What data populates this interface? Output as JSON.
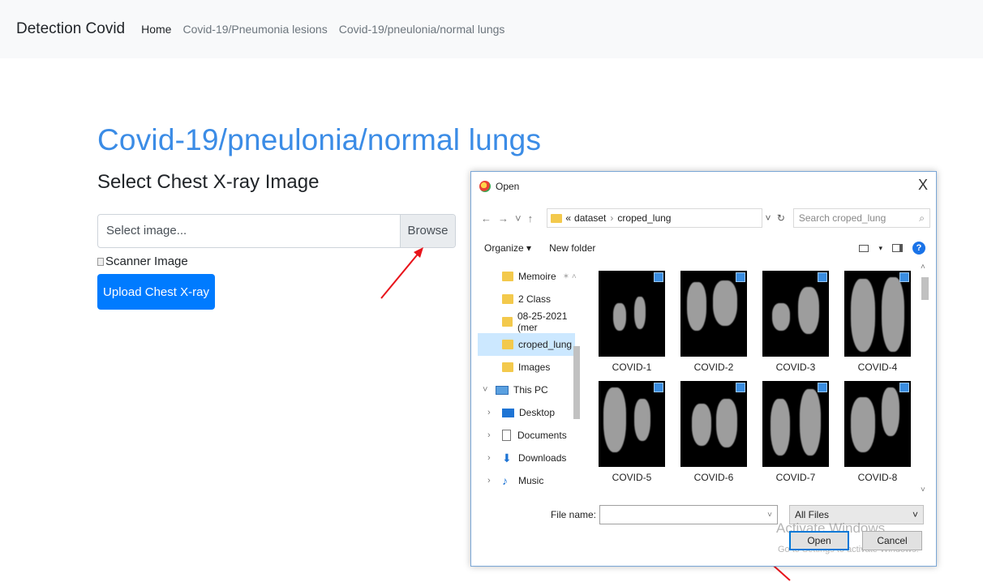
{
  "navbar": {
    "brand": "Detection Covid",
    "links": [
      "Home",
      "Covid-19/Pneumonia lesions",
      "Covid-19/pneulonia/normal lungs"
    ]
  },
  "main": {
    "title": "Covid-19/pneulonia/normal lungs",
    "subtitle": "Select Chest X-ray Image",
    "file_placeholder": "Select image...",
    "browse_label": "Browse",
    "image_alt": "Scanner Image",
    "upload_label": "Upload Chest X-ray"
  },
  "dialog": {
    "title": "Open",
    "close_glyph": "X",
    "breadcrumb_prefix": "«",
    "breadcrumb": [
      "dataset",
      "croped_lung"
    ],
    "search_placeholder": "Search croped_lung",
    "organize_label": "Organize ▾",
    "new_folder_label": "New folder",
    "sidebar_items": [
      {
        "label": "Memoire",
        "icon": "folder-icon"
      },
      {
        "label": "2 Class",
        "icon": "folder-icon"
      },
      {
        "label": "08-25-2021 (mer",
        "icon": "folder-icon"
      },
      {
        "label": "croped_lung",
        "icon": "folder-icon",
        "selected": true
      },
      {
        "label": "Images",
        "icon": "folder-icon"
      },
      {
        "label": "This PC",
        "icon": "computer-icon"
      },
      {
        "label": "Desktop",
        "icon": "desktop-icon"
      },
      {
        "label": "Documents",
        "icon": "documents-icon"
      },
      {
        "label": "Downloads",
        "icon": "downloads-icon"
      },
      {
        "label": "Music",
        "icon": "music-icon"
      }
    ],
    "files": [
      "COVID-1",
      "COVID-2",
      "COVID-3",
      "COVID-4",
      "COVID-5",
      "COVID-6",
      "COVID-7",
      "COVID-8"
    ],
    "file_name_label": "File name:",
    "file_name_value": "",
    "filter_value": "All Files",
    "open_label": "Open",
    "cancel_label": "Cancel",
    "watermark_line1": "Activate Windows",
    "watermark_line2": "Go to Settings to activate Windows."
  },
  "colors": {
    "title_blue": "#3b8ce6",
    "button_blue": "#007bff",
    "annotation_red": "#e8141b"
  }
}
